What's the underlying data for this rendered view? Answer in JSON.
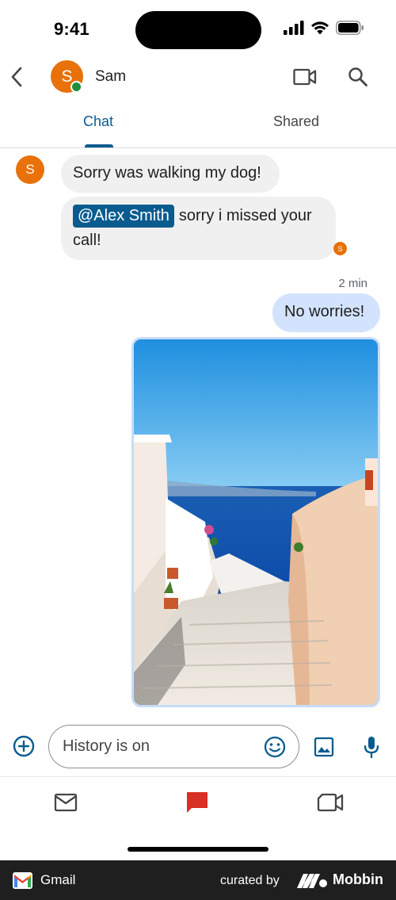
{
  "status_bar": {
    "time": "9:41"
  },
  "header": {
    "contact_name": "Sam",
    "avatar_initial": "S"
  },
  "tabs": [
    {
      "label": "Chat",
      "selected": true
    },
    {
      "label": "Shared",
      "selected": false
    }
  ],
  "messages": {
    "sender_initial": "S",
    "incoming_1": "Sorry was walking my dog!",
    "incoming_2_mention": "@Alex Smith",
    "incoming_2_text": "sorry i missed your call!",
    "read_receipt_initial": "S",
    "timestamp": "2 min",
    "outgoing_1": "No worries!"
  },
  "composer": {
    "placeholder": "History is on"
  },
  "footer": {
    "app_label": "Gmail",
    "curated_label": "curated by",
    "brand_label": "Mobbin"
  },
  "icons": {
    "back": "chevron-left-icon",
    "video": "video-camera-icon",
    "search": "search-icon",
    "add": "add-circle-icon",
    "emoji": "emoji-icon",
    "gallery": "image-icon",
    "mic": "microphone-icon",
    "nav_mail": "mail-icon",
    "nav_chat": "chat-icon",
    "nav_meet": "meet-icon"
  },
  "colors": {
    "accent": "#0a5c8f",
    "avatar": "#e8710a",
    "presence": "#1e8e3e",
    "outgoing_bubble": "#d3e3fd",
    "incoming_bubble": "#f0f0f0",
    "chat_nav_active": "#d93025"
  }
}
